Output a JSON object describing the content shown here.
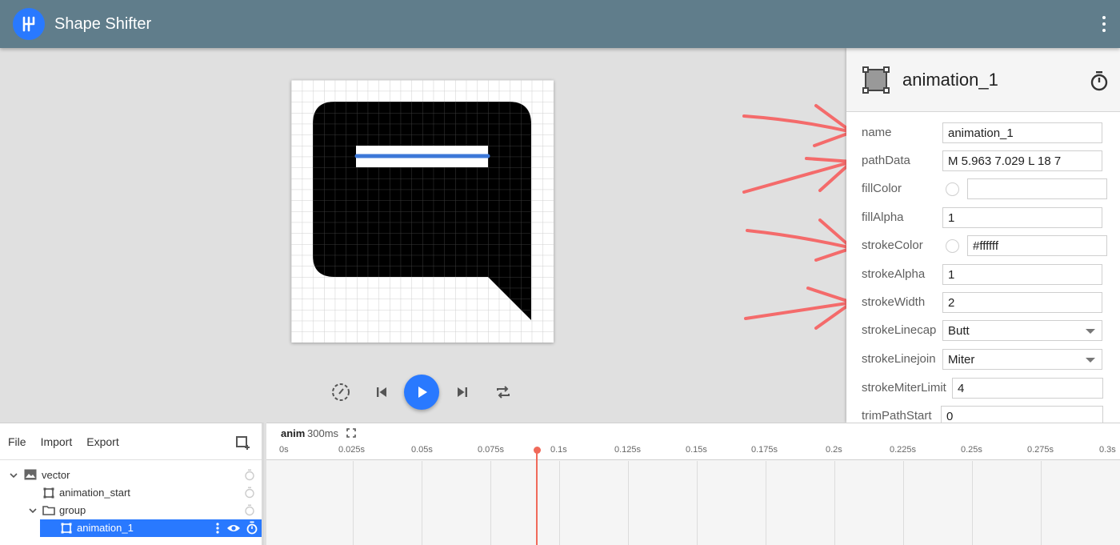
{
  "app": {
    "title": "Shape Shifter"
  },
  "properties": {
    "title": "animation_1",
    "rows": [
      {
        "label": "name",
        "value": "animation_1"
      },
      {
        "label": "pathData",
        "value": "M 5.963 7.029 L 18 7"
      },
      {
        "label": "fillColor",
        "value": ""
      },
      {
        "label": "fillAlpha",
        "value": "1"
      },
      {
        "label": "strokeColor",
        "value": "#ffffff"
      },
      {
        "label": "strokeAlpha",
        "value": "1"
      },
      {
        "label": "strokeWidth",
        "value": "2"
      },
      {
        "label": "strokeLinecap",
        "value": "Butt"
      },
      {
        "label": "strokeLinejoin",
        "value": "Miter"
      },
      {
        "label": "strokeMiterLimit",
        "value": "4"
      },
      {
        "label": "trimPathStart",
        "value": "0"
      }
    ]
  },
  "layers": {
    "toolbar": {
      "file": "File",
      "import": "Import",
      "export": "Export"
    },
    "items": [
      {
        "label": "vector"
      },
      {
        "label": "animation_start"
      },
      {
        "label": "group"
      },
      {
        "label": "animation_1"
      }
    ]
  },
  "timeline": {
    "anim_name": "anim",
    "duration": "300ms",
    "ticks": [
      "0s",
      "0.025s",
      "0.05s",
      "0.075s",
      "0.1s",
      "0.125s",
      "0.15s",
      "0.175s",
      "0.2s",
      "0.225s",
      "0.25s",
      "0.275s",
      "0.3s"
    ],
    "current_time": "0.092s"
  },
  "colors": {
    "header": "#607d8b",
    "accent": "#2979ff",
    "arrow": "#f46b6b",
    "playhead": "#f06a5a"
  }
}
